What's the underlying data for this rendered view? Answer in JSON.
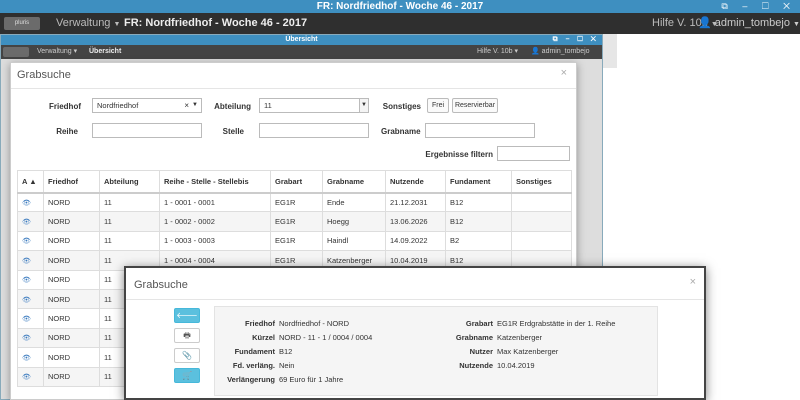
{
  "titlebar": {
    "title": "FR: Nordfriedhof - Woche 46 - 2017",
    "buttons": "⧉ – ☐ ✕"
  },
  "navbar": {
    "logo": "pluris",
    "menu": "Verwaltung",
    "title": "FR: Nordfriedhof - Woche 46 - 2017",
    "help": "Hilfe V. 10b",
    "user": "admin_tombejo"
  },
  "inner_window": {
    "title": "Übersicht",
    "buttons": "⧉ – ☐ ✕",
    "menu": "Verwaltung",
    "page_title": "Übersicht",
    "help": "Hilfe V. 10b",
    "user": "admin_tombejo"
  },
  "search_modal": {
    "title": "Grabsuche",
    "close": "×",
    "labels": {
      "friedhof": "Friedhof",
      "abteilung": "Abteilung",
      "sonstiges": "Sonstiges",
      "reihe": "Reihe",
      "stelle": "Stelle",
      "grabname": "Grabname",
      "filter": "Ergebnisse filtern"
    },
    "fields": {
      "friedhof": "Nordfriedhof",
      "abteilung": "11",
      "reihe": "",
      "stelle": "",
      "grabname": "",
      "filter": ""
    },
    "buttons": {
      "frei": "Frei",
      "reservierbar": "Reservierbar"
    },
    "table": {
      "headers": [
        "A",
        "Friedhof",
        "Abteilung",
        "Reihe - Stelle - Stellebis",
        "Grabart",
        "Grabname",
        "Nutzende",
        "Fundament",
        "Sonstiges"
      ],
      "rows": [
        [
          "NORD",
          "11",
          "1 - 0001 - 0001",
          "EG1R",
          "Ende",
          "21.12.2031",
          "B12",
          ""
        ],
        [
          "NORD",
          "11",
          "1 - 0002 - 0002",
          "EG1R",
          "Hoegg",
          "13.06.2026",
          "B12",
          ""
        ],
        [
          "NORD",
          "11",
          "1 - 0003 - 0003",
          "EG1R",
          "Haindl",
          "14.09.2022",
          "B2",
          ""
        ],
        [
          "NORD",
          "11",
          "1 - 0004 - 0004",
          "EG1R",
          "Katzenberger",
          "10.04.2019",
          "B12",
          ""
        ],
        [
          "NORD",
          "11",
          "",
          "",
          "",
          "",
          "",
          ""
        ],
        [
          "NORD",
          "11",
          "",
          "",
          "",
          "",
          "",
          ""
        ],
        [
          "NORD",
          "11",
          "",
          "",
          "",
          "",
          "",
          ""
        ],
        [
          "NORD",
          "11",
          "",
          "",
          "",
          "",
          "",
          ""
        ],
        [
          "NORD",
          "11",
          "",
          "",
          "",
          "",
          "",
          ""
        ],
        [
          "NORD",
          "11",
          "",
          "",
          "",
          "",
          "",
          ""
        ]
      ]
    }
  },
  "detail_modal": {
    "title": "Grabsuche",
    "close": "×",
    "labels": {
      "friedhof": "Friedhof",
      "kuerzel": "Kürzel",
      "fundament": "Fundament",
      "fd_verlaeng": "Fd. verläng.",
      "verlaengerung": "Verlängerung",
      "grabart": "Grabart",
      "grabname": "Grabname",
      "nutzer": "Nutzer",
      "nutzende": "Nutzende"
    },
    "values": {
      "friedhof": "Nordfriedhof - NORD",
      "kuerzel": "NORD - 11 - 1 / 0004 / 0004",
      "fundament": "B12",
      "fd_verlaeng": "Nein",
      "verlaengerung": "69 Euro für 1 Jahre",
      "grabart": "EG1R Erdgrabstätte in der 1. Reihe",
      "grabname": "Katzenberger",
      "nutzer": "Max Katzenberger",
      "nutzende": "10.04.2019"
    }
  }
}
